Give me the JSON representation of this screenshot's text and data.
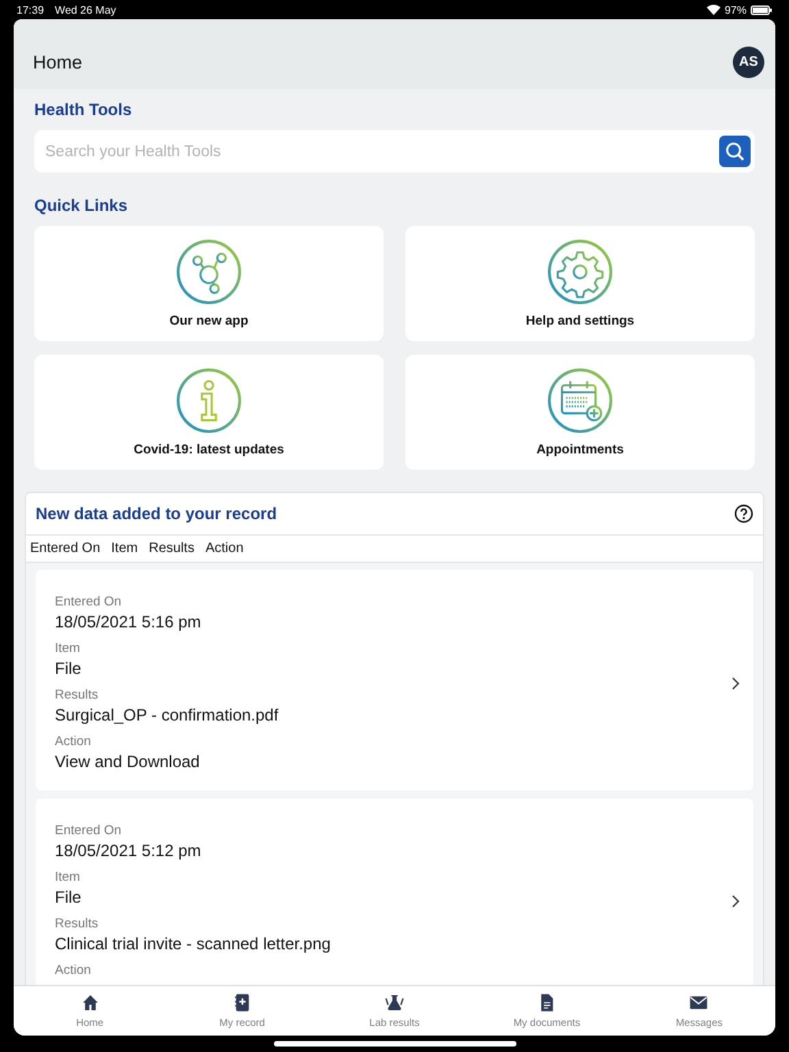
{
  "status_bar": {
    "time": "17:39",
    "date": "Wed 26 May",
    "battery": "97%"
  },
  "header": {
    "title": "Home",
    "avatar": "AS"
  },
  "health_tools": {
    "title": "Health Tools",
    "search": {
      "placeholder": "Search your Health Tools"
    }
  },
  "quick_links": {
    "title": "Quick Links",
    "items": [
      {
        "label": "Our new app",
        "kind": "network"
      },
      {
        "label": "Help and settings",
        "kind": "gear"
      },
      {
        "label": "Covid-19: latest updates",
        "kind": "info"
      },
      {
        "label": "Appointments",
        "kind": "calendar"
      }
    ]
  },
  "record": {
    "title": "New data added to your record",
    "columns": [
      "Entered On",
      "Item",
      "Results",
      "Action"
    ],
    "entries": [
      {
        "fields": [
          {
            "label": "Entered On",
            "value": "18/05/2021 5:16 pm"
          },
          {
            "label": "Item",
            "value": "File"
          },
          {
            "label": "Results",
            "value": "Surgical_OP - confirmation.pdf"
          },
          {
            "label": "Action",
            "value": "View and Download"
          }
        ]
      },
      {
        "fields": [
          {
            "label": "Entered On",
            "value": "18/05/2021 5:12 pm"
          },
          {
            "label": "Item",
            "value": "File"
          },
          {
            "label": "Results",
            "value": "Clinical trial invite - scanned letter.png"
          },
          {
            "label": "Action"
          }
        ]
      }
    ]
  },
  "tab_bar": {
    "items": [
      {
        "label": "Home",
        "kind": "home"
      },
      {
        "label": "My record",
        "kind": "record"
      },
      {
        "label": "Lab results",
        "kind": "lab"
      },
      {
        "label": "My documents",
        "kind": "document"
      },
      {
        "label": "Messages",
        "kind": "mail"
      }
    ]
  }
}
